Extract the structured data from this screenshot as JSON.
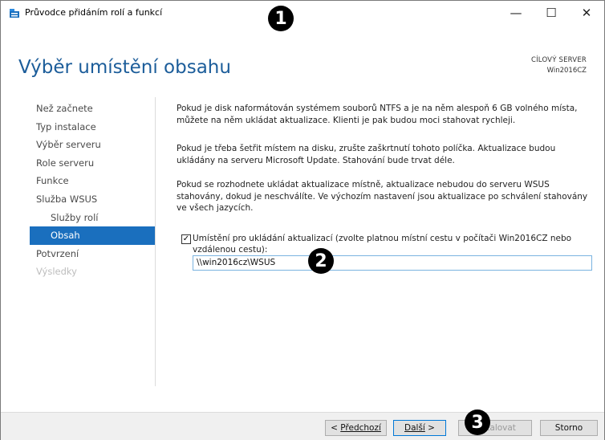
{
  "window": {
    "title": "Průvodce přidáním rolí a funkcí",
    "controls": {
      "minimize": "—",
      "maximize": "☐",
      "close": "✕"
    }
  },
  "header": {
    "title": "Výběr umístění obsahu",
    "target_label": "CÍLOVÝ SERVER",
    "target_value": "Win2016CZ"
  },
  "sidebar": {
    "items": [
      {
        "label": "Než začnete",
        "state": "normal"
      },
      {
        "label": "Typ instalace",
        "state": "normal"
      },
      {
        "label": "Výběr serveru",
        "state": "normal"
      },
      {
        "label": "Role serveru",
        "state": "normal"
      },
      {
        "label": "Funkce",
        "state": "normal"
      },
      {
        "label": "Služba WSUS",
        "state": "normal"
      },
      {
        "label": "Služby rolí",
        "state": "sub"
      },
      {
        "label": "Obsah",
        "state": "active"
      },
      {
        "label": "Potvrzení",
        "state": "normal"
      },
      {
        "label": "Výsledky",
        "state": "disabled"
      }
    ]
  },
  "content": {
    "p1": "Pokud je disk naformátován systémem souborů NTFS a je na něm alespoň 6 GB volného místa, můžete na něm ukládat aktualizace. Klienti je pak budou moci stahovat rychleji.",
    "p2": "Pokud je třeba šetřit místem na disku, zrušte zaškrtnutí tohoto políčka. Aktualizace budou ukládány na serveru Microsoft Update. Stahování bude trvat déle.",
    "p3": "Pokud se rozhodnete ukládat aktualizace místně, aktualizace nebudou do serveru WSUS stahovány, dokud je neschválíte. Ve výchozím nastavení jsou aktualizace po schválení stahovány ve všech jazycích.",
    "checkbox_label": "Umístění pro ukládání aktualizací (zvolte platnou místní cestu v počítači Win2016CZ nebo vzdálenou cestu):",
    "checkbox_checked": true,
    "path_value": "\\\\win2016cz\\WSUS"
  },
  "footer": {
    "prev_prefix": "< ",
    "prev_label": "Předchozí",
    "next_label": "Další",
    "next_suffix": " >",
    "install_label": "Instalovat",
    "cancel_label": "Storno"
  },
  "markers": [
    "1",
    "2",
    "3"
  ]
}
